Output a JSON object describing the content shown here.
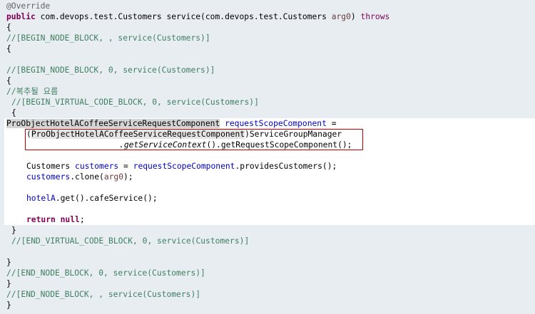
{
  "code": {
    "l1_annotation": "@Override",
    "l2_public": "public",
    "l2_sig": " com.devops.test.Customers service(com.devops.test.Customers ",
    "l2_param": "arg0",
    "l2_close": ") ",
    "l2_throws": "throws",
    "l3": "{",
    "l4_comment": "//[BEGIN_NODE_BLOCK, , service(Customers)]",
    "l5": "{",
    "l7_comment": "//[BEGIN_NODE_BLOCK, 0, service(Customers)]",
    "l8": "{",
    "l9_comment": "//복추될 요름",
    "l10_comment": "//[BEGIN_VIRTUAL_CODE_BLOCK, 0, service(Customers)]",
    "l11": "{",
    "l12_type": "ProObjectHotelACoffeeServiceRequestComponent",
    "l12_var": "requestScopeComponent",
    "l12_eq": " =",
    "l13_open": "(",
    "l13_type": "ProObjectHotelACoffeeServiceRequestComponent",
    "l13_rest": ")ServiceGroupManager",
    "l14_dot": ".",
    "l14_italic": "getServiceContext",
    "l14_rest": "().getRequestScopeComponent();",
    "l16_type": "Customers ",
    "l16_var": "customers",
    "l16_eq": " = ",
    "l16_ref": "requestScopeComponent",
    "l16_rest": ".providesCustomers();",
    "l17_var": "customers",
    "l17_mid": ".clone(",
    "l17_param": "arg0",
    "l17_end": ");",
    "l19_field": "hotelA",
    "l19_rest": ".get().cafeService();",
    "l21_return": "return",
    "l21_null": "null",
    "l21_end": ";",
    "l22": "}",
    "l23_comment": "//[END_VIRTUAL_CODE_BLOCK, 0, service(Customers)]",
    "l25": "}",
    "l26_comment": "//[END_NODE_BLOCK, 0, service(Customers)]",
    "l27": "}",
    "l28_comment": "//[END_NODE_BLOCK, , service(Customers)]",
    "l29": "}"
  }
}
